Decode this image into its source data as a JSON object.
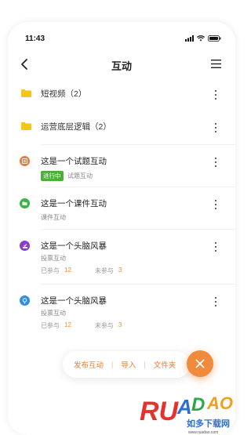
{
  "status_bar": {
    "time": "11:43"
  },
  "navbar": {
    "title": "互动"
  },
  "folders": [
    {
      "label": "短视频（2）"
    },
    {
      "label": "运营底层逻辑（2）"
    }
  ],
  "items": [
    {
      "title": "这是一个试题互动",
      "badge": "进行中",
      "type": "试题互动",
      "icon": "quiz-icon",
      "color": "#f07a3c"
    },
    {
      "title": "这是一个课件互动",
      "type": "课件互动",
      "icon": "courseware-icon",
      "color": "#3cb34a"
    },
    {
      "title": "这是一个头脑风暴",
      "type": "投票互动",
      "icon": "vote-icon",
      "color": "#8a3cd0",
      "joined_label": "已参与",
      "joined": "12",
      "not_joined_label": "未参与",
      "not_joined": "3"
    },
    {
      "title": "这是一个头脑风暴",
      "type": "投票互动",
      "icon": "brainstorm-icon",
      "color": "#2f8fe8",
      "joined_label": "已参与",
      "joined": "12",
      "not_joined_label": "未参与",
      "not_joined": "3"
    }
  ],
  "action_bar": {
    "publish": "发布互动",
    "import": "导入",
    "folder": "文件夹"
  },
  "watermark": {
    "brand": "RUANDAO",
    "tagline": "如多下载网",
    "url": "www.ruadao.com"
  },
  "colors": {
    "accent": "#f08a3c",
    "folder": "#f5c518",
    "badge": "#4caf37"
  }
}
